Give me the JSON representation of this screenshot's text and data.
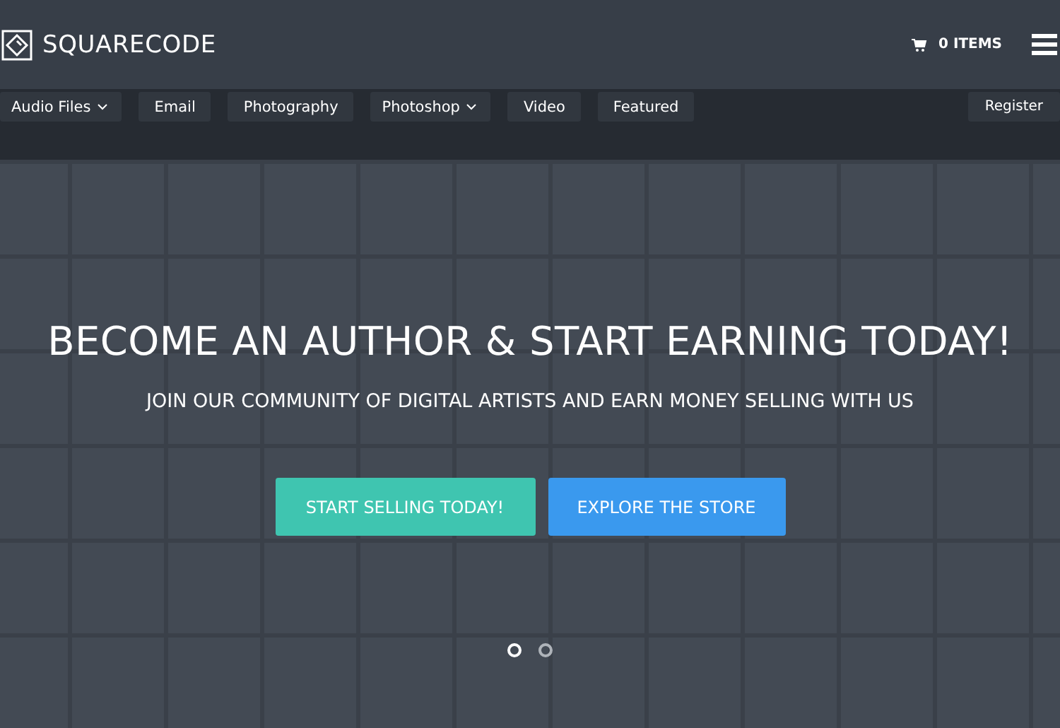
{
  "header": {
    "logo": "SQUARECODE",
    "cart": "0 ITEMS"
  },
  "nav": {
    "items": [
      {
        "label": "Audio Files",
        "dropdown": true
      },
      {
        "label": "Email",
        "dropdown": false
      },
      {
        "label": "Photography",
        "dropdown": false
      },
      {
        "label": "Photoshop",
        "dropdown": true
      },
      {
        "label": "Video",
        "dropdown": false
      },
      {
        "label": "Featured",
        "dropdown": false
      }
    ],
    "register": "Register"
  },
  "hero": {
    "title": "BECOME AN AUTHOR & START EARNING TODAY!",
    "subtitle": "JOIN OUR COMMUNITY OF DIGITAL ARTISTS AND EARN MONEY SELLING WITH US",
    "buttons": [
      {
        "label": "START SELLING TODAY!",
        "kind": "primary"
      },
      {
        "label": "EXPLORE THE STORE",
        "kind": "secondary"
      }
    ],
    "dots": [
      {
        "selected": true
      },
      {
        "selected": false
      }
    ]
  }
}
